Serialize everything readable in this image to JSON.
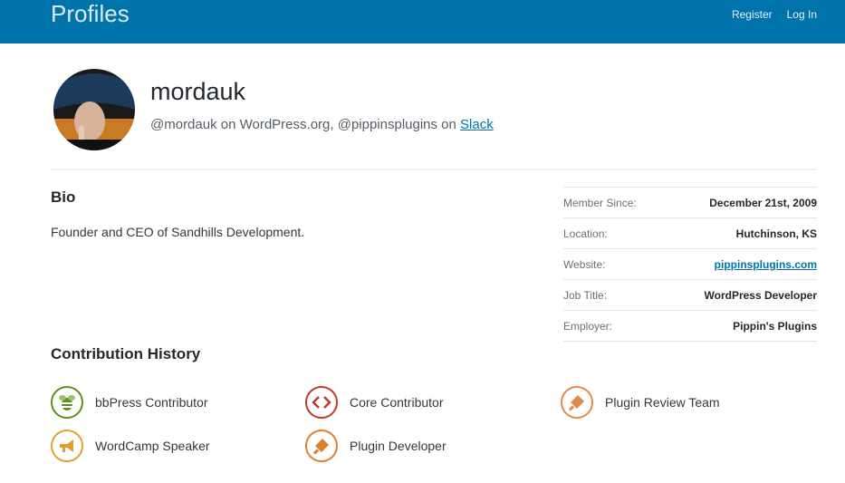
{
  "header": {
    "site_title": "Profiles",
    "nav": {
      "register": "Register",
      "login": "Log In"
    }
  },
  "profile": {
    "username": "mordauk",
    "handle_wp": "@mordauk",
    "on_wp": " on WordPress.org, ",
    "handle_slack": "@pippinsplugins",
    "on_slack": " on ",
    "slack_link": "Slack"
  },
  "bio": {
    "title": "Bio",
    "text": "Founder and CEO of Sandhills Development."
  },
  "details": [
    {
      "label": "Member Since:",
      "value": "December 21st, 2009"
    },
    {
      "label": "Location:",
      "value": "Hutchinson, KS"
    },
    {
      "label": "Website:",
      "value": "pippinsplugins.com"
    },
    {
      "label": "Job Title:",
      "value": "WordPress Developer"
    },
    {
      "label": "Employer:",
      "value": "Pippin's Plugins"
    }
  ],
  "contributions": {
    "title": "Contribution History",
    "badges": [
      {
        "label": "bbPress Contributor",
        "icon": "bee-icon",
        "color": "#5c8e1d"
      },
      {
        "label": "Core Contributor",
        "icon": "code-icon",
        "color": "#c0392b"
      },
      {
        "label": "Plugin Review Team",
        "icon": "plugin-icon",
        "color": "#e08a4b"
      },
      {
        "label": "WordCamp Speaker",
        "icon": "megaphone-icon",
        "color": "#e0a030"
      },
      {
        "label": "Plugin Developer",
        "icon": "plugin-icon",
        "color": "#d9822b"
      }
    ]
  },
  "colors": {
    "header_bg": "#0073aa",
    "link": "#0073aa"
  }
}
